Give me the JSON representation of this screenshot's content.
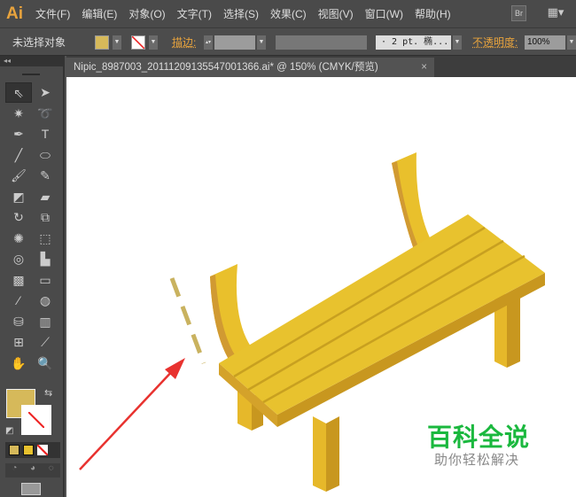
{
  "app": {
    "logo": "Ai"
  },
  "menu": [
    "文件(F)",
    "编辑(E)",
    "对象(O)",
    "文字(T)",
    "选择(S)",
    "效果(C)",
    "视图(V)",
    "窗口(W)",
    "帮助(H)"
  ],
  "menu_buttons": {
    "bridge": "Br",
    "workspace": "▦▾"
  },
  "control": {
    "selection_status": "未选择对象",
    "stroke_label": "描边:",
    "brush": "· 2 pt. 椭...",
    "opacity_label": "不透明度:",
    "opacity_value": "100%"
  },
  "colors": {
    "fill": "#d6b95a",
    "bench": "#e8c22e",
    "bench_dark": "#d4a22a",
    "accent": "#e8a33d",
    "watermark": "#1ab83e"
  },
  "document": {
    "tab_title": "Nipic_8987003_20111209135547001366.ai* @ 150% (CMYK/预览)",
    "close": "×"
  },
  "toolbar": {
    "collapse": "◂◂",
    "tools": [
      {
        "name": "selection",
        "glyph": "⇖"
      },
      {
        "name": "direct-selection",
        "glyph": "➤"
      },
      {
        "name": "magic-wand",
        "glyph": "✷"
      },
      {
        "name": "lasso",
        "glyph": "➰"
      },
      {
        "name": "pen",
        "glyph": "✒"
      },
      {
        "name": "type",
        "glyph": "T"
      },
      {
        "name": "line",
        "glyph": "╱"
      },
      {
        "name": "ellipse",
        "glyph": "⬭"
      },
      {
        "name": "paintbrush",
        "glyph": "🖌"
      },
      {
        "name": "pencil",
        "glyph": "✎"
      },
      {
        "name": "blob-brush",
        "glyph": "◩"
      },
      {
        "name": "eraser",
        "glyph": "▰"
      },
      {
        "name": "rotate",
        "glyph": "↻"
      },
      {
        "name": "scale",
        "glyph": "⧉"
      },
      {
        "name": "warp",
        "glyph": "✺"
      },
      {
        "name": "free-transform",
        "glyph": "⬚"
      },
      {
        "name": "shape-builder",
        "glyph": "◎"
      },
      {
        "name": "perspective-grid",
        "glyph": "▙"
      },
      {
        "name": "mesh",
        "glyph": "▩"
      },
      {
        "name": "gradient",
        "glyph": "▭"
      },
      {
        "name": "eyedropper",
        "glyph": "⁄"
      },
      {
        "name": "blend",
        "glyph": "◍"
      },
      {
        "name": "symbol-sprayer",
        "glyph": "⛁"
      },
      {
        "name": "column-graph",
        "glyph": "▥"
      },
      {
        "name": "artboard",
        "glyph": "⊞"
      },
      {
        "name": "slice",
        "glyph": "⟋"
      },
      {
        "name": "hand",
        "glyph": "✋"
      },
      {
        "name": "zoom",
        "glyph": "🔍"
      }
    ]
  },
  "watermark": {
    "title": "百科全说",
    "subtitle": "助你轻松解决"
  }
}
